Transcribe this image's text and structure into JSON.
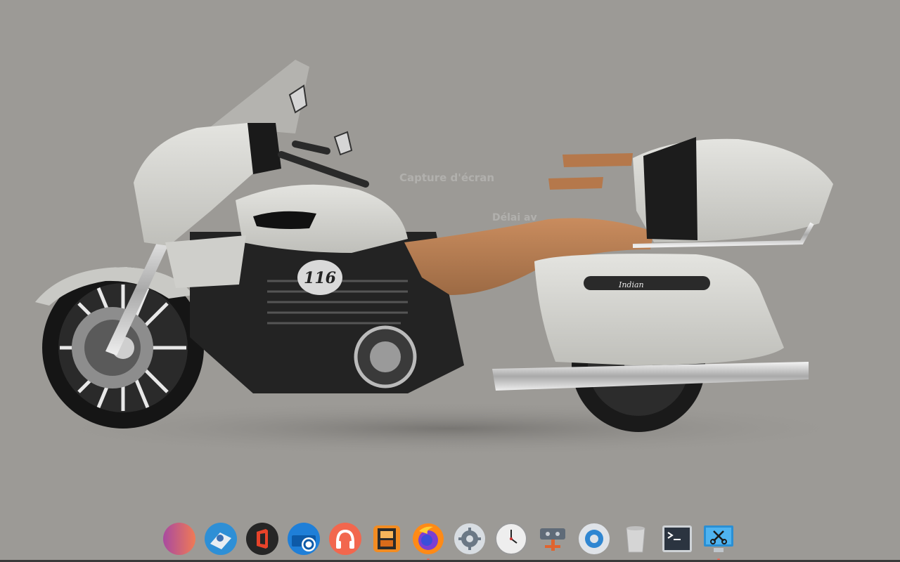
{
  "desktop": {
    "background_color": "#9c9a96",
    "wallpaper_subject": "touring motorcycle (side view) with windscreen, tan leather seat and saddlebags",
    "engine_badge": "116",
    "bag_badge": "Indian"
  },
  "ghost_dialog": {
    "title": "Capture d'écran",
    "delay_label": "Délai av"
  },
  "dock": {
    "items": [
      {
        "name": "app-launcher",
        "icon": "gradient-launcher-icon"
      },
      {
        "name": "maps",
        "icon": "map-pin-icon"
      },
      {
        "name": "office",
        "icon": "office-logo-icon"
      },
      {
        "name": "outlook",
        "icon": "mail-o-icon"
      },
      {
        "name": "music",
        "icon": "headphones-icon"
      },
      {
        "name": "video-player",
        "icon": "film-icon"
      },
      {
        "name": "firefox",
        "icon": "firefox-icon",
        "running": true
      },
      {
        "name": "settings",
        "icon": "gear-icon"
      },
      {
        "name": "clock",
        "icon": "clock-icon"
      },
      {
        "name": "network",
        "icon": "network-icon"
      },
      {
        "name": "system-settings",
        "icon": "control-center-icon"
      },
      {
        "name": "trash",
        "icon": "trash-icon"
      },
      {
        "name": "terminal",
        "icon": "terminal-icon"
      },
      {
        "name": "screenshot",
        "icon": "scissors-icon",
        "running": true
      }
    ],
    "running_indicator_color": "#e86a5a"
  }
}
